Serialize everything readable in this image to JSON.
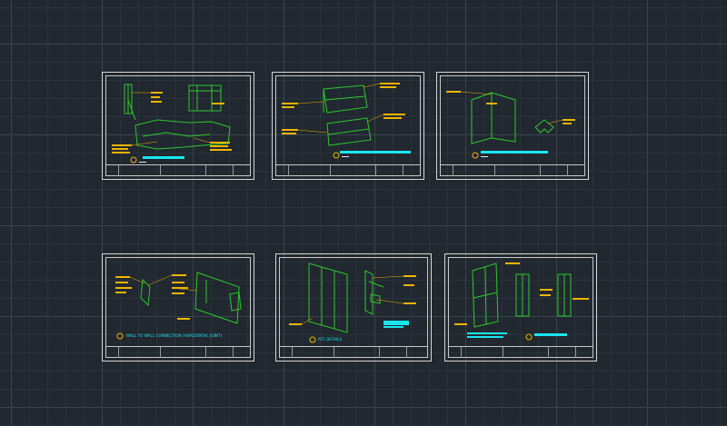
{
  "app": {
    "view": "model-space"
  },
  "colors": {
    "background": "#212830",
    "grid_major": "#3a434d",
    "grid_minor": "#2a323b",
    "sheet_border": "#d8d8d8",
    "linework": "#2ec72e",
    "annotation": "#f0b400",
    "title_bar": "#19e6f0"
  },
  "sheets": [
    {
      "id": "sheet-1",
      "title": ""
    },
    {
      "id": "sheet-2",
      "title": ""
    },
    {
      "id": "sheet-3",
      "title": ""
    },
    {
      "id": "sheet-4",
      "title": "WALL TO WALL CONNECTION (HORIZONTAL JOINT)"
    },
    {
      "id": "sheet-5",
      "title": "ATC DETAILS"
    },
    {
      "id": "sheet-6",
      "title": ""
    }
  ]
}
